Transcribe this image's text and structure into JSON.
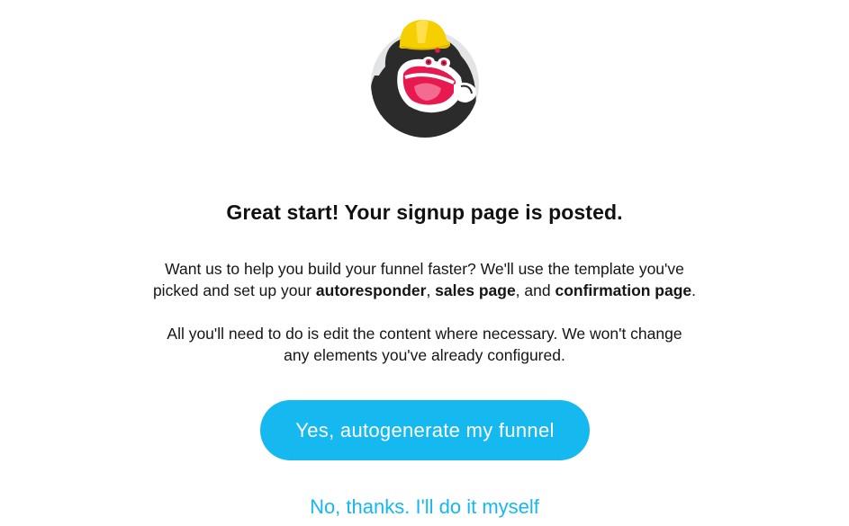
{
  "modal": {
    "title": "Great start! Your signup page is posted.",
    "paragraph1": {
      "line1": "Want us to help you build your funnel faster? We'll use the template you've",
      "line2_before": "picked and set up your ",
      "bold1": "autoresponder",
      "sep1": ", ",
      "bold2": "sales page",
      "sep2": ", and ",
      "bold3": "confirmation page",
      "end": "."
    },
    "paragraph2": {
      "line1": "All you'll need to do is edit the content where necessary. We won't change",
      "line2": "any elements you've already configured."
    },
    "primary_button": "Yes, autogenerate my funnel",
    "secondary_link": "No, thanks. I'll do it myself"
  },
  "colors": {
    "accent": "#15b8ef",
    "mascot_body": "#2b2b2b",
    "mascot_mouth": "#e8194f",
    "hard_hat": "#f5cf00",
    "mascot_background": "#e3e4e6"
  },
  "icons": {
    "mascot": "construction-mascot-icon"
  }
}
